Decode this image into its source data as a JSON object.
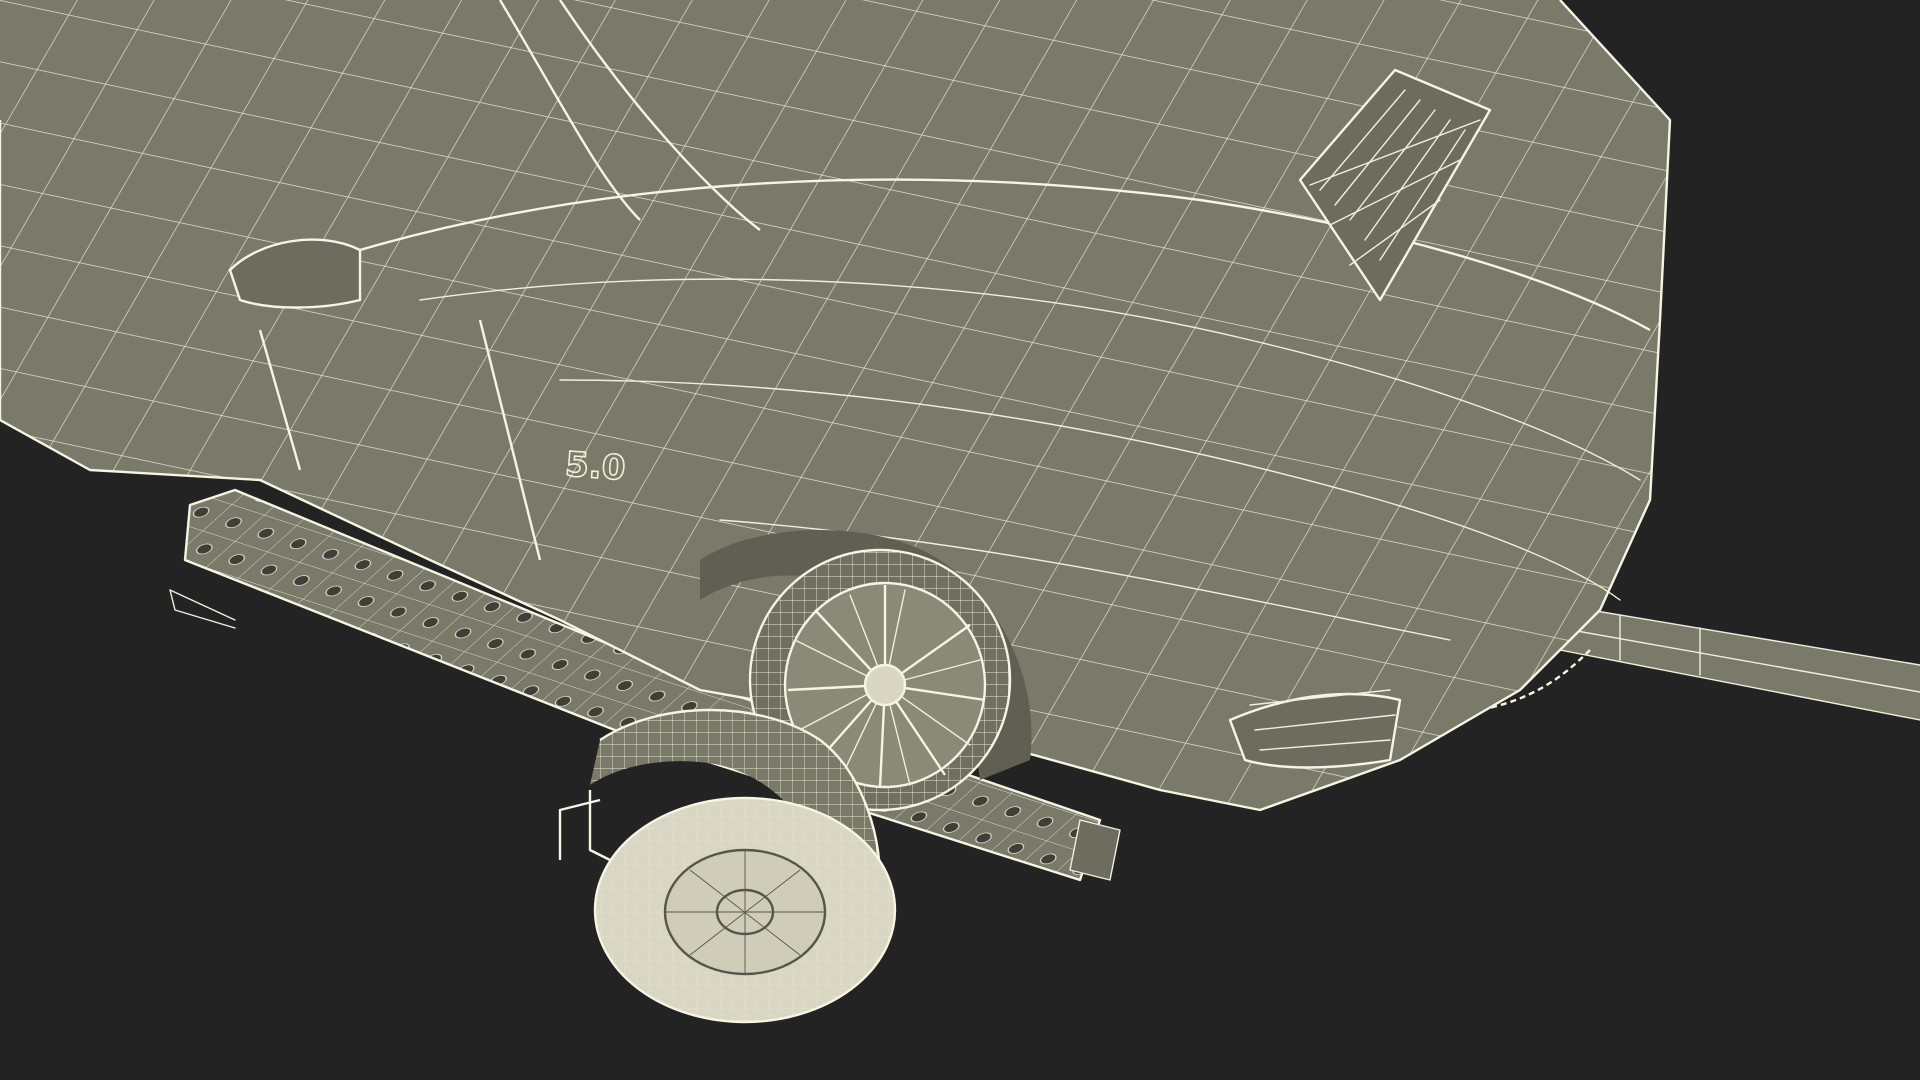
{
  "scene": {
    "subject": "wireframe-render",
    "background_color": "#232323",
    "mesh_fill_color": "#7a7a6a",
    "wire_color": "#f1efdc",
    "badge_text": "5.0"
  }
}
